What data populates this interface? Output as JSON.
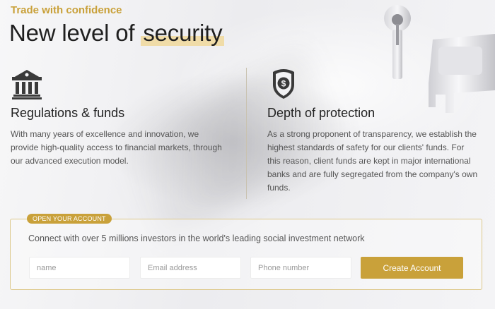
{
  "hero": {
    "tagline": "Trade with confidence",
    "headline_prefix": "New level of ",
    "headline_highlight": "security"
  },
  "features": [
    {
      "icon": "bank-building-icon",
      "title": "Regulations & funds",
      "text": "With many years of excellence and innovation, we provide high-quality access to financial markets, through our advanced execution model."
    },
    {
      "icon": "shield-dollar-icon",
      "title": "Depth of protection",
      "text": "As a strong proponent of transparency, we establish the highest standards of safety for our clients' funds. For this reason, client funds are kept in major international banks and are fully segregated from the company's own funds."
    }
  ],
  "account": {
    "badge": "OPEN YOUR ACCOUNT",
    "invite": "Connect with over 5 millions investors in the world's leading social investment network",
    "name_placeholder": "name",
    "email_placeholder": "Email address",
    "phone_placeholder": "Phone number",
    "button_label": "Create Account"
  },
  "colors": {
    "accent": "#c9a13a",
    "highlight": "#f0dca8"
  }
}
